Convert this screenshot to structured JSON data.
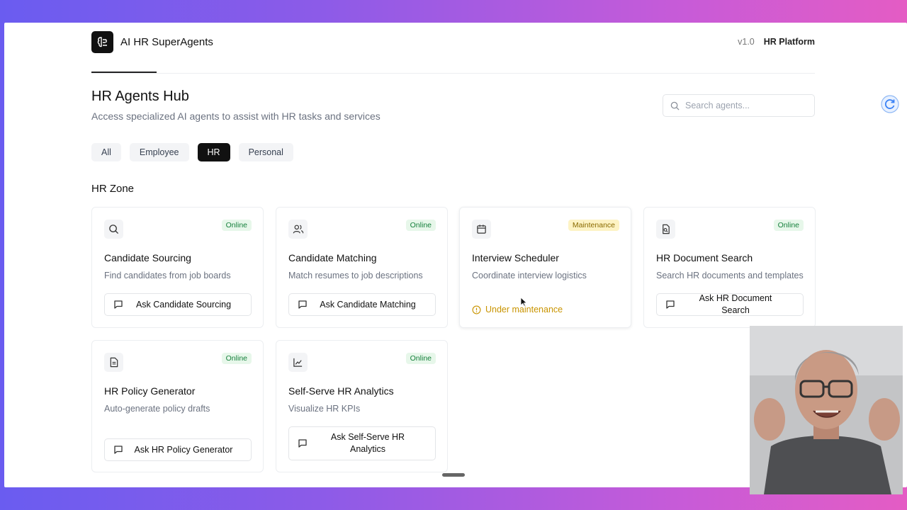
{
  "header": {
    "app_title": "AI HR SuperAgents",
    "version": "v1.0",
    "platform": "HR Platform"
  },
  "page": {
    "title": "HR Agents Hub",
    "subtitle": "Access specialized AI agents to assist with HR tasks and services"
  },
  "search": {
    "placeholder": "Search agents..."
  },
  "filters": [
    {
      "label": "All",
      "active": false
    },
    {
      "label": "Employee",
      "active": false
    },
    {
      "label": "HR",
      "active": true
    },
    {
      "label": "Personal",
      "active": false
    }
  ],
  "zone": {
    "title": "HR Zone"
  },
  "cards": [
    {
      "icon": "search-icon",
      "status": "Online",
      "title": "Candidate Sourcing",
      "desc": "Find candidates from job boards",
      "button": "Ask Candidate Sourcing"
    },
    {
      "icon": "users-icon",
      "status": "Online",
      "title": "Candidate Matching",
      "desc": "Match resumes to job descriptions",
      "button": "Ask Candidate Matching"
    },
    {
      "icon": "calendar-icon",
      "status": "Maintenance",
      "title": "Interview Scheduler",
      "desc": "Coordinate interview logistics",
      "note": "Under maintenance"
    },
    {
      "icon": "file-search-icon",
      "status": "Online",
      "title": "HR Document Search",
      "desc": "Search HR documents and templates",
      "button": "Ask HR Document Search"
    },
    {
      "icon": "document-icon",
      "status": "Online",
      "title": "HR Policy Generator",
      "desc": "Auto-generate policy drafts",
      "button": "Ask HR Policy Generator"
    },
    {
      "icon": "chart-line-icon",
      "status": "Online",
      "title": "Self-Serve HR Analytics",
      "desc": "Visualize HR KPIs",
      "button": "Ask Self-Serve HR Analytics"
    }
  ],
  "colors": {
    "online_bg": "#e7f7ea",
    "online_text": "#16803c",
    "maintenance_bg": "#fdf3c4",
    "maintenance_text": "#8a6a00",
    "accent_dark": "#111111"
  }
}
